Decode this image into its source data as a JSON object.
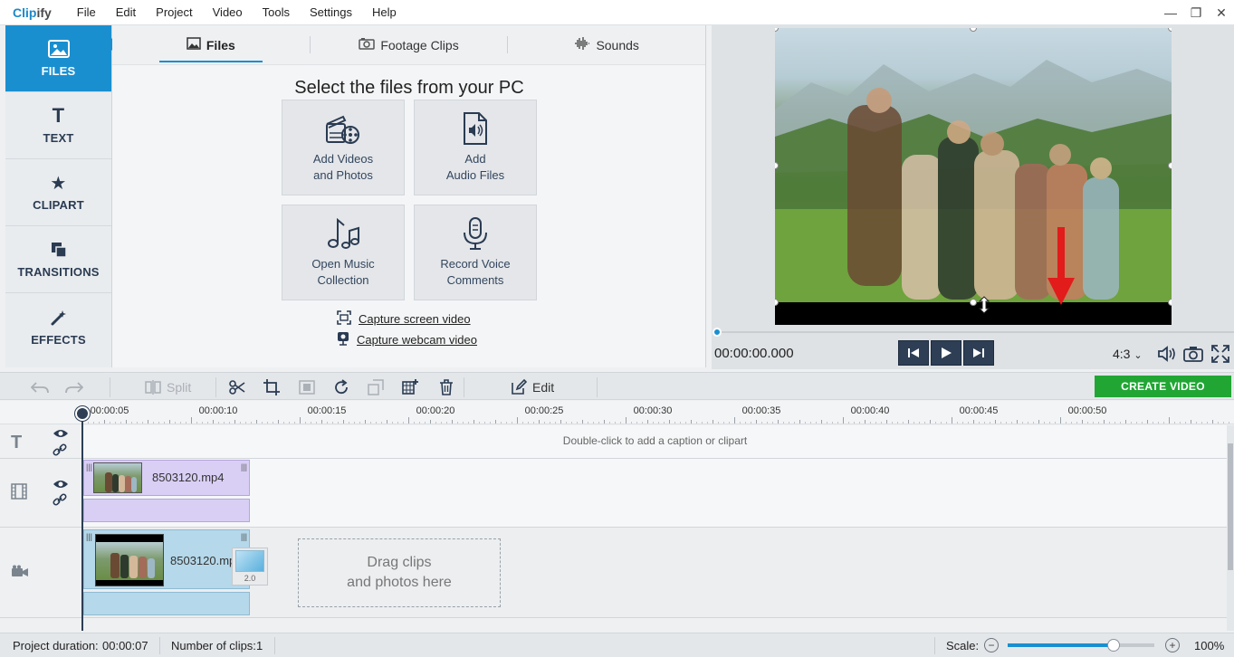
{
  "app": {
    "logo_a": "Clip",
    "logo_b": "ify"
  },
  "menu": [
    "File",
    "Edit",
    "Project",
    "Video",
    "Tools",
    "Settings",
    "Help"
  ],
  "window_controls": {
    "minimize": "—",
    "restore": "❐",
    "close": "✕"
  },
  "sidebar": {
    "items": [
      {
        "label": "FILES",
        "icon": "image-icon",
        "active": true
      },
      {
        "label": "TEXT",
        "icon": "text-icon",
        "active": false
      },
      {
        "label": "CLIPART",
        "icon": "star-icon",
        "active": false
      },
      {
        "label": "TRANSITIONS",
        "icon": "transitions-icon",
        "active": false
      },
      {
        "label": "EFFECTS",
        "icon": "magic-wand-icon",
        "active": false
      }
    ]
  },
  "files_panel": {
    "tabs": [
      {
        "label": "Files",
        "icon": "image-icon",
        "active": true
      },
      {
        "label": "Footage Clips",
        "icon": "camera-icon",
        "active": false
      },
      {
        "label": "Sounds",
        "icon": "waveform-icon",
        "active": false
      }
    ],
    "title": "Select the files from your PC",
    "tiles": [
      {
        "line1": "Add Videos",
        "line2": "and Photos",
        "icon": "film-reel-icon"
      },
      {
        "line1": "Add",
        "line2": "Audio Files",
        "icon": "audio-file-icon"
      },
      {
        "line1": "Open Music",
        "line2": "Collection",
        "icon": "music-notes-icon"
      },
      {
        "line1": "Record Voice",
        "line2": "Comments",
        "icon": "microphone-icon"
      }
    ],
    "capture_screen": "Capture screen video",
    "capture_webcam": "Capture webcam video"
  },
  "preview": {
    "timecode": "00:00:00.000",
    "aspect_ratio": "4:3",
    "aspect_chevron": "⌄"
  },
  "toolbar": {
    "split": "Split",
    "edit": "Edit",
    "create": "CREATE VIDEO"
  },
  "timeline": {
    "ticks": [
      "00:00:05",
      "00:00:10",
      "00:00:15",
      "00:00:20",
      "00:00:25",
      "00:00:30",
      "00:00:35",
      "00:00:40",
      "00:00:45",
      "00:00:50"
    ],
    "caption_hint": "Double-click to add a caption or clipart",
    "overlay_clip_name": "8503120.mp4",
    "main_clip_name": "8503120.mp4",
    "transition_badge": "2.0",
    "drag_line1": "Drag clips",
    "drag_line2": "and photos here"
  },
  "status": {
    "duration_label": "Project duration:",
    "duration_value": "00:00:07",
    "clips_label": "Number of clips:",
    "clips_value": "1",
    "scale_label": "Scale:",
    "zoom_value": "100%",
    "scale_level": 0.72
  },
  "colors": {
    "accent": "#1a8fd0",
    "create_button": "#21a634",
    "navy": "#2d3e55",
    "overlay_clip": "#d9cff5",
    "main_clip": "#b5d8ea"
  }
}
